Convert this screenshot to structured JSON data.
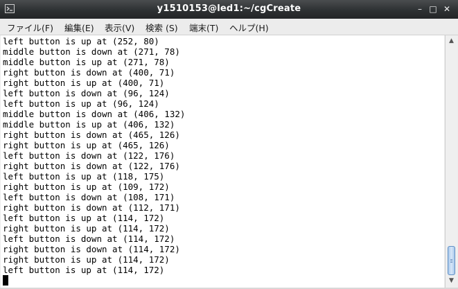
{
  "window": {
    "title": "y1510153@led1:~/cgCreate",
    "controls": {
      "minimize": "–",
      "maximize": "□",
      "close": "✕"
    }
  },
  "menu": {
    "items": [
      {
        "label": "ファイル(F)"
      },
      {
        "label": "編集(E)"
      },
      {
        "label": "表示(V)"
      },
      {
        "label": "検索 (S)"
      },
      {
        "label": "端末(T)"
      },
      {
        "label": "ヘルプ(H)"
      }
    ]
  },
  "terminal": {
    "lines": [
      "left button is up at (252, 80)",
      "middle button is down at (271, 78)",
      "middle button is up at (271, 78)",
      "right button is down at (400, 71)",
      "right button is up at (400, 71)",
      "left button is down at (96, 124)",
      "left button is up at (96, 124)",
      "middle button is down at (406, 132)",
      "middle button is up at (406, 132)",
      "right button is down at (465, 126)",
      "right button is up at (465, 126)",
      "left button is down at (122, 176)",
      "right button is down at (122, 176)",
      "left button is up at (118, 175)",
      "right button is up at (109, 172)",
      "left button is down at (108, 171)",
      "right button is down at (112, 171)",
      "left button is up at (114, 172)",
      "right button is up at (114, 172)",
      "left button is down at (114, 172)",
      "right button is down at (114, 172)",
      "right button is up at (114, 172)",
      "left button is up at (114, 172)"
    ]
  },
  "scrollbar": {
    "up_arrow": "▲",
    "down_arrow": "▼",
    "position_fraction": 1.0
  },
  "colors": {
    "titlebar": "#2e3133",
    "terminal_bg": "#ffffff",
    "terminal_fg": "#000000",
    "scroll_thumb": "#a9c8ec"
  }
}
